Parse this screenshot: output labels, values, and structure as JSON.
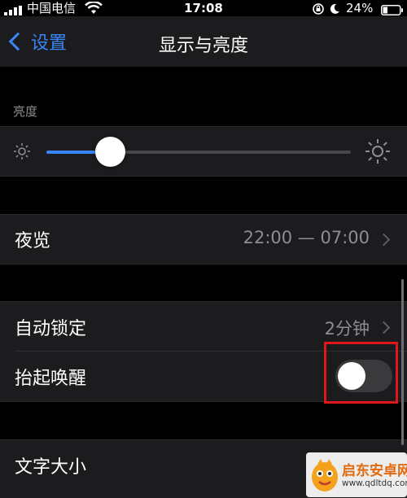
{
  "status_bar": {
    "carrier": "中国电信",
    "time": "17:08",
    "battery": "24%"
  },
  "nav": {
    "back_label": "设置",
    "title": "显示与亮度"
  },
  "brightness": {
    "section_label": "亮度",
    "level": 0.21
  },
  "night_shift": {
    "label": "夜览",
    "value": "22:00 — 07:00"
  },
  "auto_lock": {
    "label": "自动锁定",
    "value": "2分钟"
  },
  "raise_to_wake": {
    "label": "抬起唤醒",
    "enabled": false
  },
  "text_size": {
    "label": "文字大小"
  },
  "watermark": {
    "name": "启东安卓网",
    "url": "www.qdltdq.com"
  },
  "colors": {
    "accent": "#3a85f7",
    "highlight": "#e0161d",
    "cell_bg": "#1c1c1e"
  }
}
